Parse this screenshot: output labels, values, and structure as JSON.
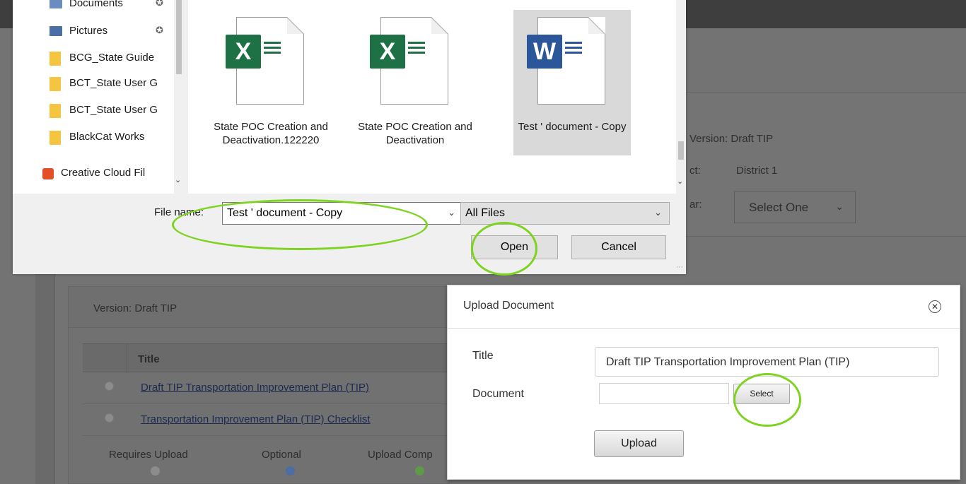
{
  "background": {
    "right_panel": {
      "version_label": "Version: Draft TIP",
      "district_label": "ct:",
      "district_value": "District 1",
      "year_label": "ar:",
      "select_placeholder": "Select One"
    },
    "card": {
      "version_label": "Version: Draft TIP",
      "table_header": "Title",
      "rows": [
        "Draft TIP Transportation Improvement Plan (TIP)",
        "Transportation Improvement Plan (TIP) Checklist"
      ],
      "legend": [
        "Requires Upload",
        "Optional",
        "Upload Comp"
      ]
    }
  },
  "file_dialog": {
    "nav_items": [
      {
        "label": "Documents"
      },
      {
        "label": "Pictures"
      },
      {
        "label": "BCG_State Guide"
      },
      {
        "label": "BCT_State User G"
      },
      {
        "label": "BCT_State User G"
      },
      {
        "label": "BlackCat Works"
      },
      {
        "label": "Creative Cloud Fil"
      }
    ],
    "files": [
      {
        "name": "State POC Creation and Deactivation.122220",
        "type": "excel",
        "icon": "X"
      },
      {
        "name": "State POC Creation and Deactivation",
        "type": "excel",
        "icon": "X"
      },
      {
        "name": "Test ' document - Copy",
        "type": "word",
        "icon": "W"
      }
    ],
    "file_name_label": "File name:",
    "file_name_value": "Test ' document - Copy",
    "file_type_value": "All Files",
    "open_label": "Open",
    "cancel_label": "Cancel"
  },
  "upload_modal": {
    "title": "Upload Document",
    "title_label": "Title",
    "title_value": "Draft TIP Transportation Improvement Plan (TIP)",
    "document_label": "Document",
    "select_label": "Select",
    "upload_label": "Upload"
  },
  "colors": {
    "annotation": "#7ed321",
    "excel": "#1e7145",
    "word": "#2b579a"
  }
}
